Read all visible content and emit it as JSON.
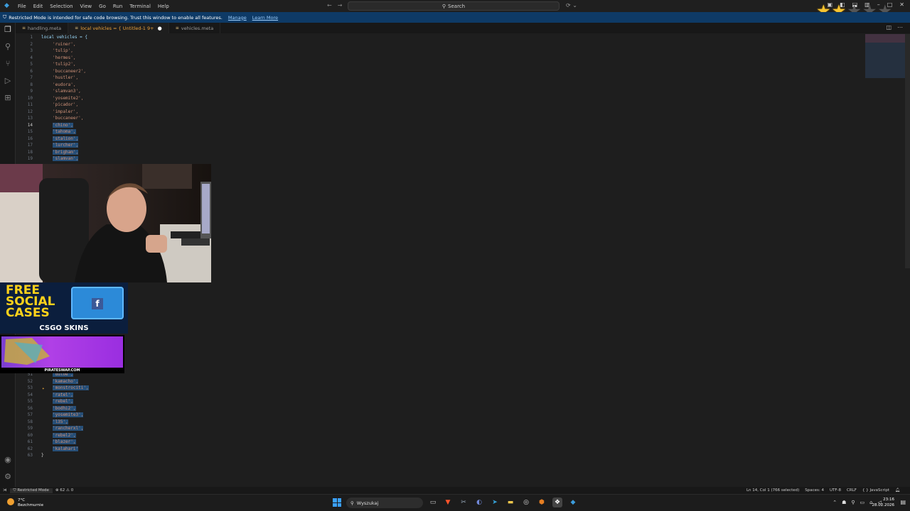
{
  "titlebar": {
    "menus": [
      "File",
      "Edit",
      "Selection",
      "View",
      "Go",
      "Run",
      "Terminal",
      "Help"
    ],
    "search_label": "Search"
  },
  "banner": {
    "message": "Restricted Mode is intended for safe code browsing. Trust this window to enable all features.",
    "manage": "Manage",
    "learn_more": "Learn More"
  },
  "stars": {
    "filled": 2,
    "total": 5
  },
  "tabs": [
    {
      "label": "handling.meta",
      "active": false
    },
    {
      "label": "local vehicles = { Untitled-1 9+",
      "active": true,
      "modified": true
    },
    {
      "label": "vehicles.meta",
      "active": false
    }
  ],
  "editor": {
    "lines_top": [
      {
        "n": "1",
        "text": "local vehicles = {",
        "kind": "header"
      },
      {
        "n": "2",
        "text": "'ruiner',",
        "sel": false
      },
      {
        "n": "3",
        "text": "'tulip',",
        "sel": false
      },
      {
        "n": "4",
        "text": "'hermes',",
        "sel": false
      },
      {
        "n": "5",
        "text": "'tulip2',",
        "sel": false
      },
      {
        "n": "6",
        "text": "'buccaneer2',",
        "sel": false
      },
      {
        "n": "7",
        "text": "'hustler',",
        "sel": false
      },
      {
        "n": "8",
        "text": "'eudora',",
        "sel": false
      },
      {
        "n": "9",
        "text": "'slamvan3',",
        "sel": false
      },
      {
        "n": "10",
        "text": "'yosemite2',",
        "sel": false
      },
      {
        "n": "11",
        "text": "'picador',",
        "sel": false
      },
      {
        "n": "12",
        "text": "'impaler',",
        "sel": false
      },
      {
        "n": "13",
        "text": "'buccaneer',",
        "sel": false
      },
      {
        "n": "14",
        "text": "'chino',",
        "sel": true
      },
      {
        "n": "15",
        "text": "'tahoma',",
        "sel": true
      },
      {
        "n": "16",
        "text": "'stalion',",
        "sel": true
      },
      {
        "n": "17",
        "text": "'lurcher',",
        "sel": true
      },
      {
        "n": "18",
        "text": "'brigham',",
        "sel": true
      },
      {
        "n": "19",
        "text": "'slamvan',",
        "sel": true
      }
    ],
    "lines_bottom": [
      {
        "n": "51",
        "text": "'duloe',",
        "sel": true
      },
      {
        "n": "52",
        "text": "'kamacho',",
        "sel": true
      },
      {
        "n": "53",
        "text": "'monstrociti',",
        "sel": true
      },
      {
        "n": "54",
        "text": "'ratel',",
        "sel": true
      },
      {
        "n": "55",
        "text": "'rebel',",
        "sel": true
      },
      {
        "n": "56",
        "text": "'bodhi2',",
        "sel": true
      },
      {
        "n": "57",
        "text": "'yosemite3',",
        "sel": true
      },
      {
        "n": "58",
        "text": "'l35',",
        "sel": true
      },
      {
        "n": "59",
        "text": "'rancherxl',",
        "sel": true
      },
      {
        "n": "60",
        "text": "'rebel2',",
        "sel": true
      },
      {
        "n": "61",
        "text": "'blazer',",
        "sel": true
      },
      {
        "n": "62",
        "text": "'kalahari'",
        "sel": true
      },
      {
        "n": "63",
        "text": "}",
        "sel": false
      }
    ]
  },
  "overlays": {
    "csgo_line1": "FREE",
    "csgo_line2": "SOCIAL",
    "csgo_line3": "CASES",
    "csgo_brand": "CSGO SKINS",
    "pirate_label": "PIRATESWAP.COM"
  },
  "statusbar": {
    "restricted": "Restricted Mode",
    "problems": "62",
    "warnings": "0",
    "position": "Ln 14, Col 1 (766 selected)",
    "spaces": "Spaces: 4",
    "encoding": "UTF-8",
    "eol": "CRLF",
    "language": "JavaScript"
  },
  "taskbar": {
    "temperature": "7°C",
    "weather": "Bezchmurnie",
    "search_placeholder": "Wyszukaj",
    "time": "23:16",
    "date": "28.02.2026"
  },
  "colors": {
    "editor_bg": "#1e1e1e",
    "selection": "#264f78",
    "string": "#ce9178",
    "banner": "#0e3a66"
  }
}
